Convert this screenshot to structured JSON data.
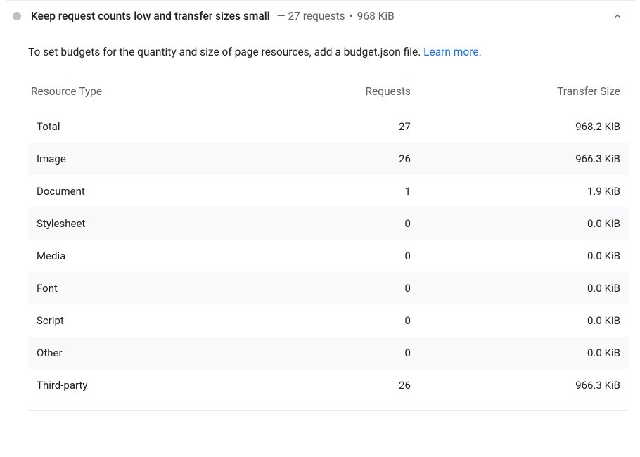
{
  "audit": {
    "title": "Keep request counts low and transfer sizes small",
    "summary_prefix": "—",
    "summary_requests": "27 requests",
    "summary_dot": "•",
    "summary_size": "968 KiB",
    "description": "To set budgets for the quantity and size of page resources, add a budget.json file. ",
    "learn_more": "Learn more",
    "period": "."
  },
  "table": {
    "headers": {
      "resource_type": "Resource Type",
      "requests": "Requests",
      "transfer_size": "Transfer Size"
    },
    "rows": [
      {
        "type": "Total",
        "requests": "27",
        "size": "968.2 KiB"
      },
      {
        "type": "Image",
        "requests": "26",
        "size": "966.3 KiB"
      },
      {
        "type": "Document",
        "requests": "1",
        "size": "1.9 KiB"
      },
      {
        "type": "Stylesheet",
        "requests": "0",
        "size": "0.0 KiB"
      },
      {
        "type": "Media",
        "requests": "0",
        "size": "0.0 KiB"
      },
      {
        "type": "Font",
        "requests": "0",
        "size": "0.0 KiB"
      },
      {
        "type": "Script",
        "requests": "0",
        "size": "0.0 KiB"
      },
      {
        "type": "Other",
        "requests": "0",
        "size": "0.0 KiB"
      },
      {
        "type": "Third-party",
        "requests": "26",
        "size": "966.3 KiB"
      }
    ]
  }
}
